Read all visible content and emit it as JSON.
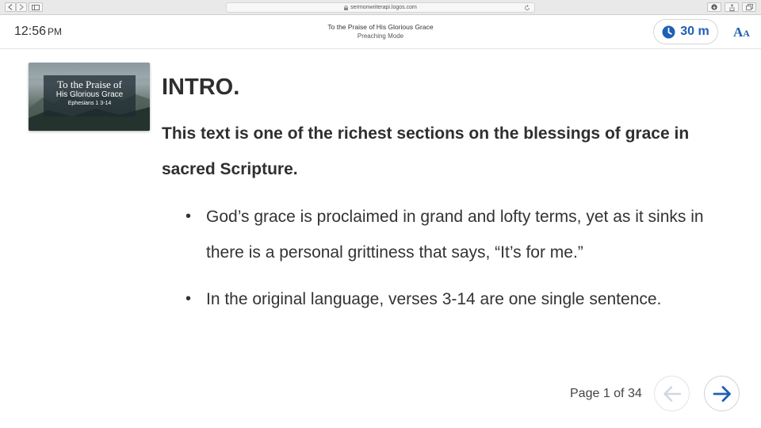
{
  "browser": {
    "url": "sermonwriterapi.logos.com"
  },
  "header": {
    "time": "12:56",
    "ampm": "PM",
    "title": "To the Praise of His Glorious Grace",
    "subtitle": "Preaching Mode",
    "timer": "30 m",
    "font_size_big": "A",
    "font_size_small": "A"
  },
  "thumbnail": {
    "title": "To the Praise of",
    "subtitle": "His Glorious Grace",
    "reference": "Ephesians 1 3-14"
  },
  "content": {
    "heading": "INTRO.",
    "paragraph": "This text is one of the richest sections on the blessings of grace in sacred Scripture.",
    "bullets": [
      {
        "marker": "•",
        "text": "God’s grace is proclaimed in grand and lofty terms, yet as it sinks in there is a personal grittiness that says, “It’s for me.”"
      },
      {
        "marker": "•",
        "text": "In the original language, verses 3-14 are one single sentence."
      }
    ]
  },
  "footer": {
    "page_label": "Page 1 of 34"
  },
  "colors": {
    "accent": "#1f5fb5",
    "disabled": "#d0d7e2"
  }
}
